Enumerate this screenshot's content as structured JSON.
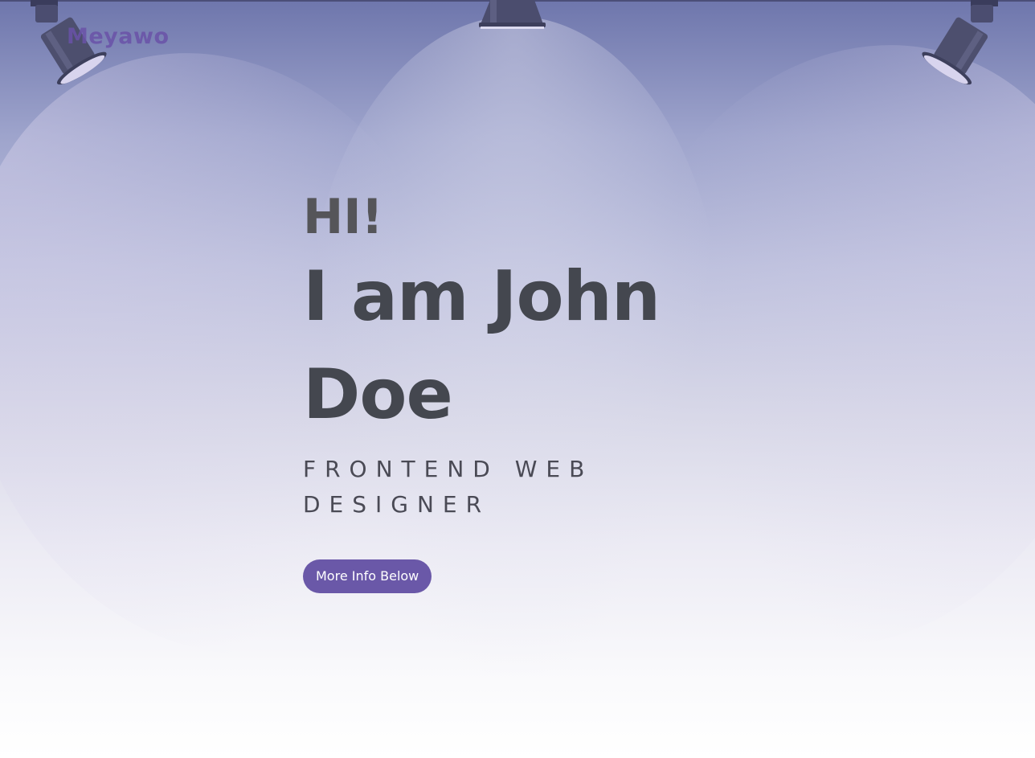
{
  "header": {
    "logo": "Meyawo"
  },
  "hero": {
    "greeting": "HI!",
    "name": "I am John Doe",
    "role": "FRONTEND WEB DESIGNER",
    "cta_label": "More Info Below"
  },
  "colors": {
    "accent": "#6a58a8",
    "logo": "#6a52a8",
    "heading": "#44474f",
    "background_top": "#6e76ac",
    "background_bottom": "#ffffff"
  },
  "icons": {
    "left": "spotlight-icon",
    "center": "spotlight-icon",
    "right": "spotlight-icon"
  }
}
